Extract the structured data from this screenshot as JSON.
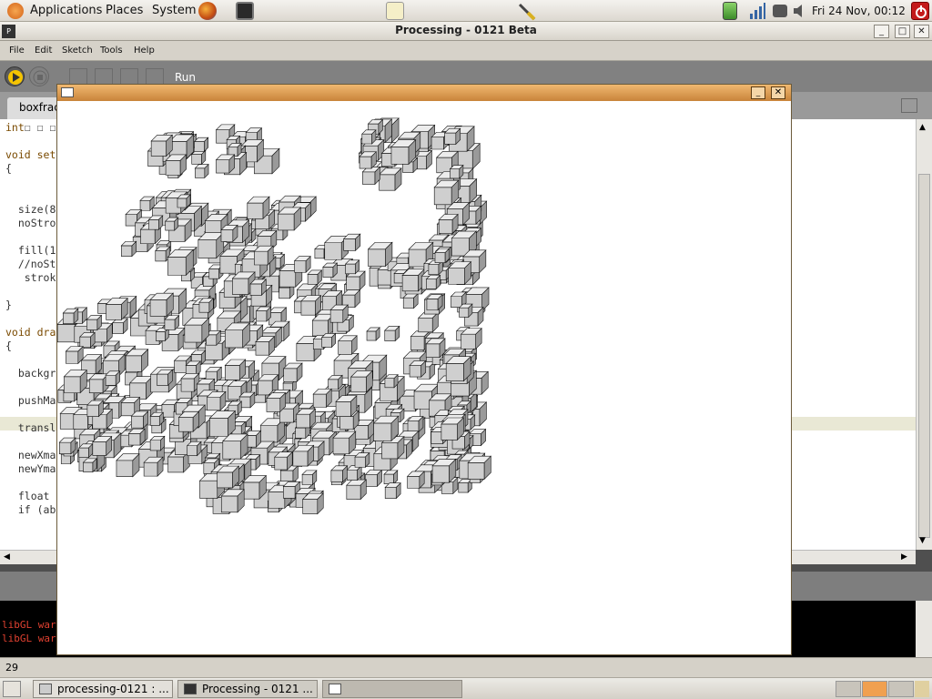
{
  "panel": {
    "menus": [
      "Applications",
      "Places",
      "System"
    ],
    "clock": "Fri 24 Nov, 00:12"
  },
  "window": {
    "title": "Processing - 0121 Beta",
    "menus": [
      "File",
      "Edit",
      "Sketch",
      "Tools",
      "Help"
    ],
    "run_label": "Run",
    "tab_label": "boxfrac",
    "line_number": "29"
  },
  "code": [
    {
      "kw": "int",
      "rest": "☐ ☐ ☐"
    },
    {
      "kw": "",
      "rest": ""
    },
    {
      "kw": "void set",
      "rest": ""
    },
    {
      "kw": "",
      "rest": "{"
    },
    {
      "kw": "",
      "rest": ""
    },
    {
      "kw": "",
      "rest": ""
    },
    {
      "kw": "",
      "rest": "  size(8"
    },
    {
      "kw": "",
      "rest": "  noStro"
    },
    {
      "kw": "",
      "rest": ""
    },
    {
      "kw": "",
      "rest": "  fill(1"
    },
    {
      "kw": "",
      "rest": "  //noSt"
    },
    {
      "kw": "",
      "rest": "   strok"
    },
    {
      "kw": "",
      "rest": ""
    },
    {
      "kw": "",
      "rest": "}"
    },
    {
      "kw": "",
      "rest": ""
    },
    {
      "kw": "void dra",
      "rest": ""
    },
    {
      "kw": "",
      "rest": "{"
    },
    {
      "kw": "",
      "rest": ""
    },
    {
      "kw": "",
      "rest": "  backgr"
    },
    {
      "kw": "",
      "rest": ""
    },
    {
      "kw": "",
      "rest": "  pushMa"
    },
    {
      "kw": "",
      "rest": ""
    },
    {
      "kw": "",
      "rest": "  transl"
    },
    {
      "kw": "",
      "rest": ""
    },
    {
      "kw": "",
      "rest": "  newXma"
    },
    {
      "kw": "",
      "rest": "  newYma"
    },
    {
      "kw": "",
      "rest": ""
    },
    {
      "kw": "",
      "rest": "  float"
    },
    {
      "kw": "",
      "rest": "  if (ab"
    }
  ],
  "console_lines": [
    "libGL war",
    "libGL war"
  ],
  "taskbar": {
    "tasks": [
      "processing-0121 : ...",
      "Processing - 0121 ...",
      ""
    ]
  },
  "colors": {
    "toolbar": "#818181",
    "run_button": "#f5c400",
    "sketch_frame": "#d28f42",
    "console_text": "#e04030"
  }
}
